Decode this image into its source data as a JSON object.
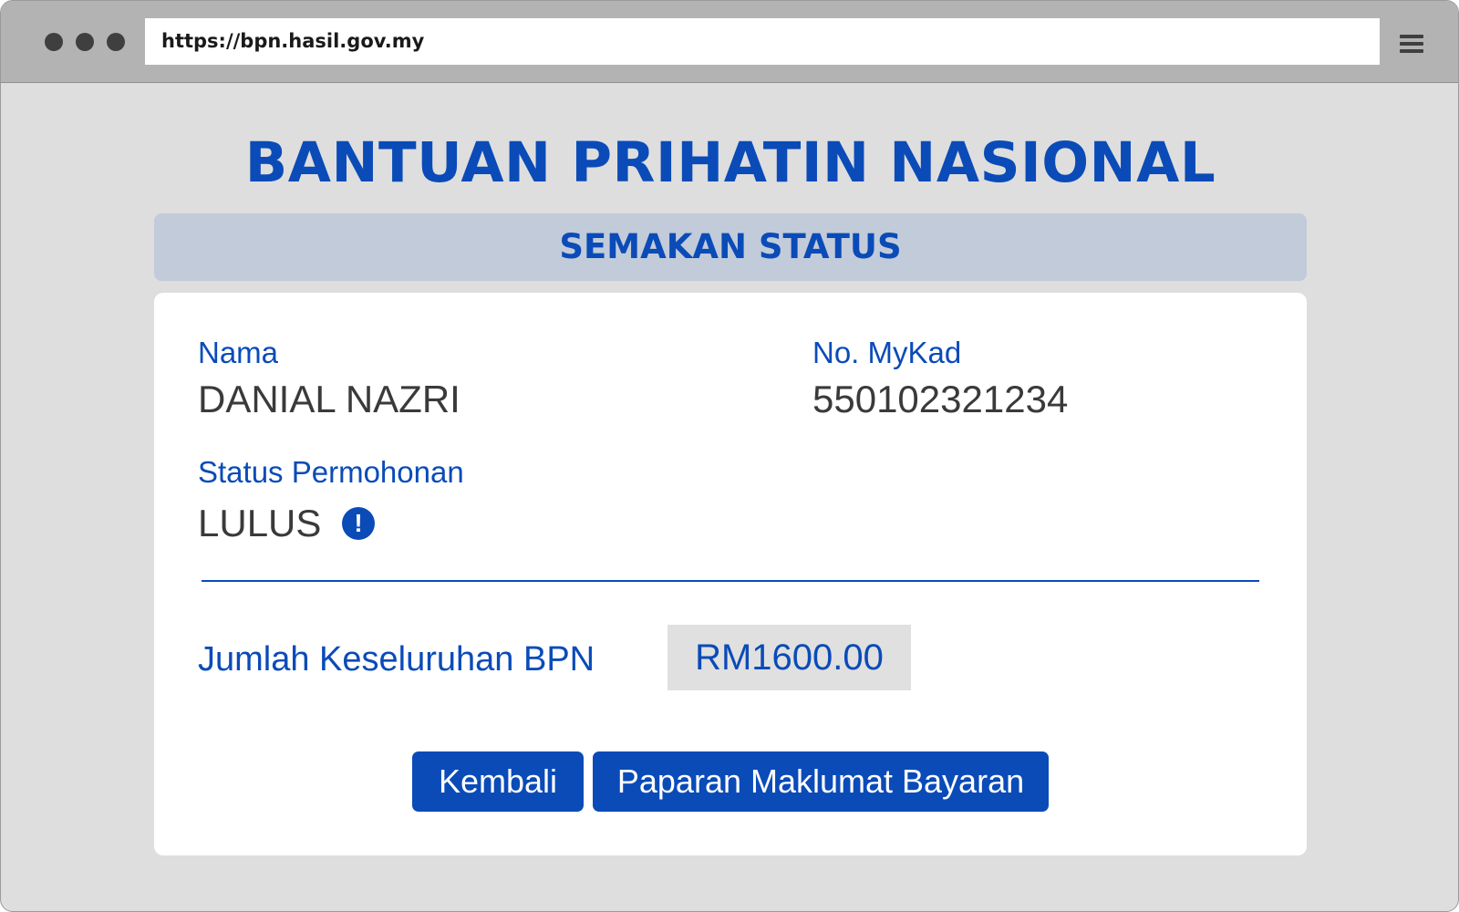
{
  "browser": {
    "url": "https://bpn.hasil.gov.my"
  },
  "page": {
    "title": "BANTUAN PRIHATIN NASIONAL",
    "section_title": "SEMAKAN STATUS"
  },
  "details": {
    "name_label": "Nama",
    "name_value": "DANIAL NAZRI",
    "mykad_label": "No. MyKad",
    "mykad_value": "550102321234",
    "status_label": "Status Permohonan",
    "status_value": "LULUS",
    "status_icon": "info-icon",
    "status_icon_glyph": "!"
  },
  "total": {
    "label": "Jumlah Keseluruhan BPN",
    "value": "RM1600.00"
  },
  "actions": {
    "back_label": "Kembali",
    "payment_label": "Paparan Maklumat Bayaran"
  },
  "colors": {
    "accent": "#0a4bb8",
    "header_band": "#c2cbd9",
    "background": "#dedede"
  }
}
